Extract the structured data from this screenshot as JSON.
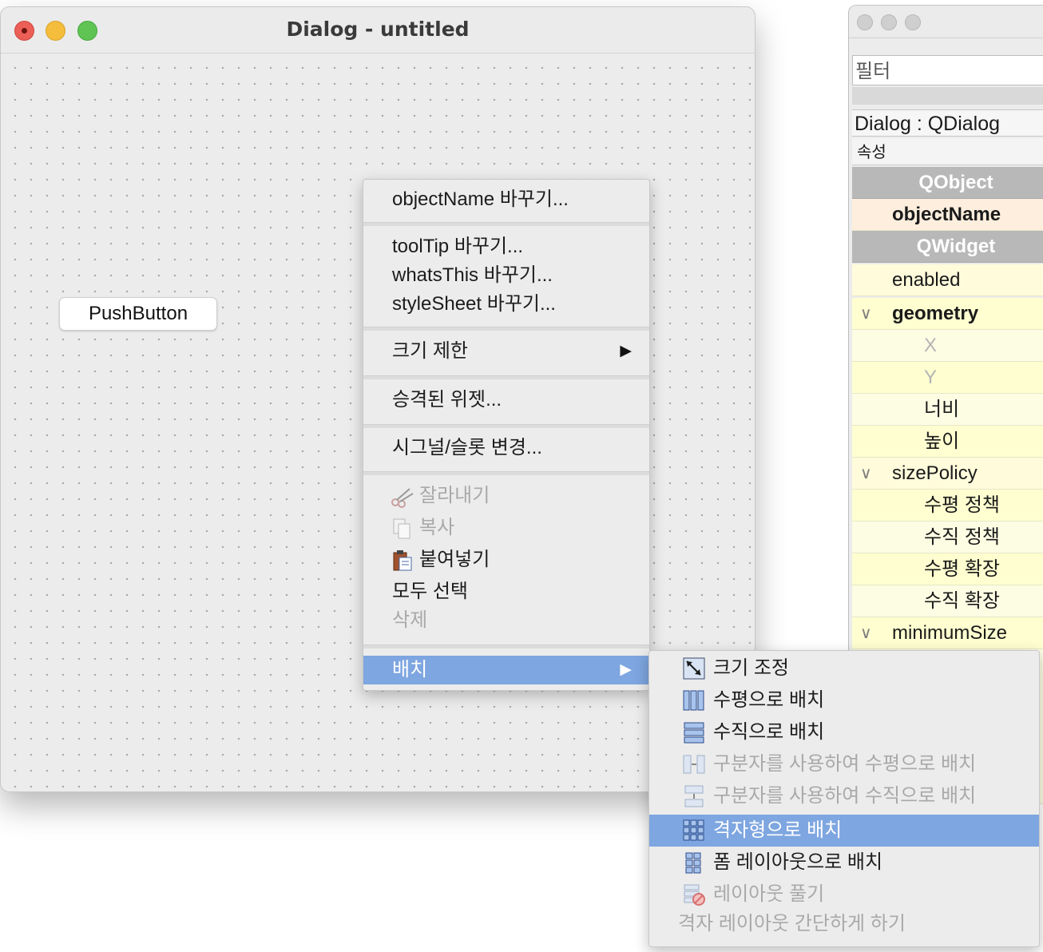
{
  "dialog": {
    "title": "Dialog - untitled",
    "push_button_label": "PushButton"
  },
  "context_menu": {
    "items": [
      {
        "label": "objectName 바꾸기...",
        "enabled": true
      },
      {
        "label": "toolTip 바꾸기...",
        "enabled": true
      },
      {
        "label": "whatsThis 바꾸기...",
        "enabled": true
      },
      {
        "label": "styleSheet 바꾸기...",
        "enabled": true
      },
      {
        "label": "크기 제한",
        "enabled": true,
        "submenu": true
      },
      {
        "label": "승격된 위젯...",
        "enabled": true
      },
      {
        "label": "시그널/슬롯 변경...",
        "enabled": true
      },
      {
        "label": "잘라내기",
        "enabled": false,
        "icon": "scissors-icon"
      },
      {
        "label": "복사",
        "enabled": false,
        "icon": "copy-icon"
      },
      {
        "label": "붙여넣기",
        "enabled": true,
        "icon": "paste-icon"
      },
      {
        "label": "모두 선택",
        "enabled": true
      },
      {
        "label": "삭제",
        "enabled": false
      },
      {
        "label": "배치",
        "enabled": true,
        "submenu": true,
        "highlighted": true
      }
    ],
    "submenu_arrow": "▶"
  },
  "layout_submenu": {
    "items": [
      {
        "label": "크기 조정",
        "enabled": true,
        "icon": "adjust-size-icon"
      },
      {
        "label": "수평으로 배치",
        "enabled": true,
        "icon": "horizontal-layout-icon"
      },
      {
        "label": "수직으로 배치",
        "enabled": true,
        "icon": "vertical-layout-icon"
      },
      {
        "label": "구분자를 사용하여 수평으로 배치",
        "enabled": false,
        "icon": "horizontal-splitter-icon"
      },
      {
        "label": "구분자를 사용하여 수직으로 배치",
        "enabled": false,
        "icon": "vertical-splitter-icon"
      },
      {
        "label": "격자형으로 배치",
        "enabled": true,
        "icon": "grid-layout-icon",
        "highlighted": true
      },
      {
        "label": "폼 레이아웃으로 배치",
        "enabled": true,
        "icon": "form-layout-icon"
      },
      {
        "label": "레이아웃 풀기",
        "enabled": false,
        "icon": "break-layout-icon"
      },
      {
        "label": "격자 레이아웃 간단하게 하기",
        "enabled": false
      }
    ]
  },
  "property_editor": {
    "filter_placeholder": "필터",
    "object_label": "Dialog : QDialog",
    "column_header": "속성",
    "rows": [
      {
        "label": "QObject",
        "kind": "group"
      },
      {
        "label": "objectName",
        "kind": "bold"
      },
      {
        "label": "QWidget",
        "kind": "group"
      },
      {
        "label": "enabled",
        "kind": "plain"
      },
      {
        "label": "geometry",
        "kind": "bold-expanded"
      },
      {
        "label": "X",
        "kind": "child-dim"
      },
      {
        "label": "Y",
        "kind": "child-dim"
      },
      {
        "label": "너비",
        "kind": "child"
      },
      {
        "label": "높이",
        "kind": "child"
      },
      {
        "label": "sizePolicy",
        "kind": "expanded"
      },
      {
        "label": "수평 정책",
        "kind": "child"
      },
      {
        "label": "수직 정책",
        "kind": "child"
      },
      {
        "label": "수평 확장",
        "kind": "child"
      },
      {
        "label": "수직 확장",
        "kind": "child"
      },
      {
        "label": "minimumSize",
        "kind": "expanded"
      }
    ],
    "chevron": "∨"
  },
  "colors": {
    "menu_highlight": "#7ea6e0",
    "property_yellow": "#fefed0",
    "group_gray": "#b8b8b8"
  }
}
